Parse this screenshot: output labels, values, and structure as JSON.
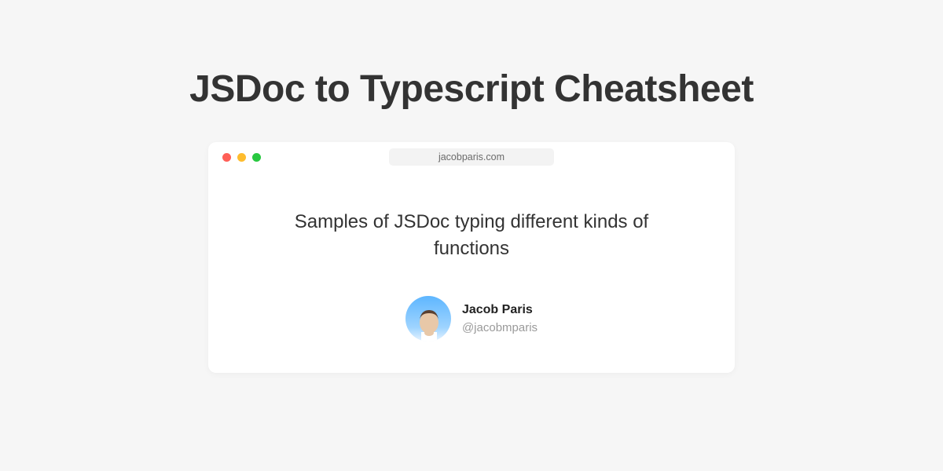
{
  "title": "JSDoc to Typescript Cheatsheet",
  "browser": {
    "url": "jacobparis.com"
  },
  "card": {
    "subtitle": "Samples of JSDoc typing different kinds of functions",
    "author": {
      "name": "Jacob Paris",
      "handle": "@jacobmparis"
    }
  }
}
